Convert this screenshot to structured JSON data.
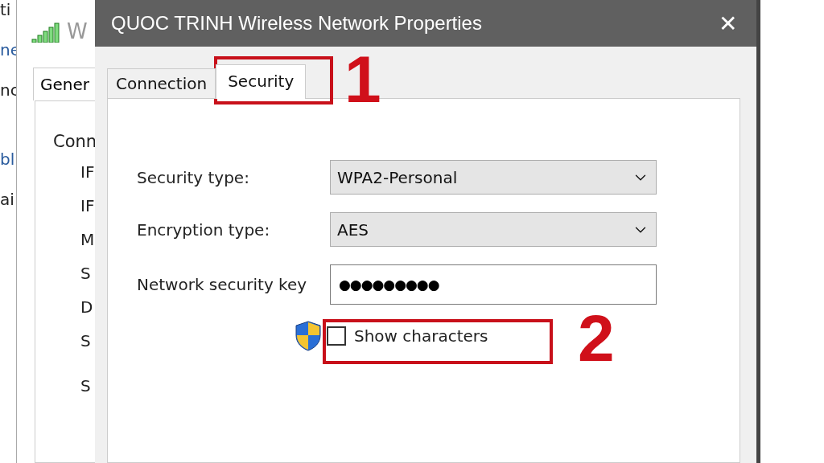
{
  "left_window": {
    "lines": [
      {
        "text": "ti",
        "link": false
      },
      {
        "text": "ne",
        "link": true
      },
      {
        "text": "nc",
        "link": false
      },
      {
        "text": "bl",
        "link": true
      },
      {
        "text": "ai",
        "link": false
      }
    ]
  },
  "status_window": {
    "title": "W",
    "tab": "Gener",
    "heading": "Conn",
    "rows": [
      "IF",
      "IF",
      "M",
      "S",
      "D",
      "S",
      "S"
    ]
  },
  "dialog": {
    "title": "QUOC TRINH Wireless Network Properties",
    "close": "✕",
    "tabs": [
      {
        "label": "Connection",
        "selected": false
      },
      {
        "label": "Security",
        "selected": true
      }
    ],
    "fields": [
      {
        "kind": "dropdown",
        "label": "Security type:",
        "value": "WPA2-Personal"
      },
      {
        "kind": "dropdown",
        "label": "Encryption type:",
        "value": "AES"
      },
      {
        "kind": "password",
        "label": "Network security key",
        "value": "●●●●●●●●●"
      }
    ],
    "show_characters": {
      "label": "Show characters",
      "checked": false
    }
  },
  "annotations": [
    {
      "number": "1"
    },
    {
      "number": "2"
    }
  ]
}
